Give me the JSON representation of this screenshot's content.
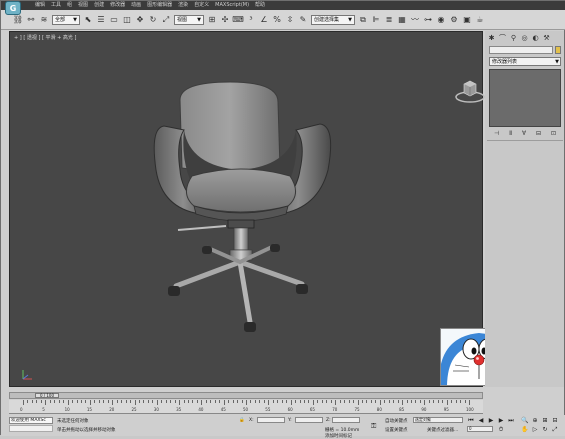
{
  "menubar": {
    "app_icon": "3ds-max-logo-icon",
    "items": [
      "编辑",
      "工具",
      "组",
      "视图",
      "创建",
      "修改器",
      "动画",
      "图形编辑器",
      "渲染",
      "自定义",
      "MAXScript(M)",
      "帮助"
    ]
  },
  "toolbar": {
    "selection_filter": "全部",
    "ref_coord": "视图",
    "named_selection": "创建选择集"
  },
  "viewport": {
    "label": "+ ] [ 透视 ] [ 平滑 + 高光 ]",
    "icons": [
      "viewcube-icon",
      "axis-tripod-icon",
      "office-chair-model"
    ]
  },
  "command_panel": {
    "tabs": [
      "create-icon",
      "modify-icon",
      "hierarchy-icon",
      "motion-icon",
      "display-icon",
      "utilities-icon"
    ],
    "modifier_list": "修改器列表",
    "stack_buttons": [
      "pin-stack-icon",
      "show-end-result-icon",
      "make-unique-icon",
      "remove-modifier-icon",
      "configure-modifier-icon"
    ],
    "color": "#e2c04c"
  },
  "timeline": {
    "frame_label": "0 / 100",
    "ticks": [
      "0",
      "5",
      "10",
      "15",
      "20",
      "25",
      "30",
      "35",
      "40",
      "45",
      "50",
      "55",
      "60",
      "65",
      "70",
      "75",
      "80",
      "85",
      "90",
      "95",
      "100"
    ]
  },
  "status": {
    "welcome": "欢迎使用 MAXSc",
    "prompt1": "未选定任何对象",
    "prompt2": "单击并拖动以选择并移动对象",
    "x_label": "X:",
    "y_label": "Y:",
    "z_label": "Z:",
    "grid": "栅格 = 10.0mm",
    "auto_key": "自动关键点",
    "selected": "选定对象",
    "set_key": "设置关键点",
    "key_filter": "关键点过滤器...",
    "add_time_tag": "添加时间标记",
    "frame": "0"
  },
  "overlay": {
    "image": "doraemon-face-image"
  }
}
